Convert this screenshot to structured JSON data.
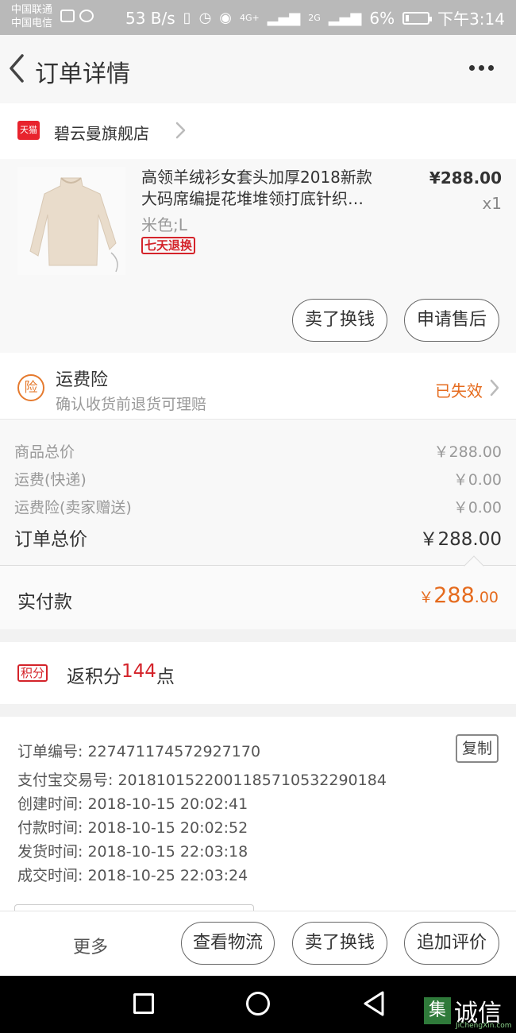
{
  "status_bar": {
    "carrier1": "中国联通",
    "carrier2": "中国电信",
    "speed": "53 B/s",
    "net4g": "4G+",
    "net2g": "2G",
    "battery": "6%",
    "time": "下午3:14"
  },
  "header": {
    "title": "订单详情"
  },
  "shop": {
    "badge": "天猫",
    "name": "碧云曼旗舰店"
  },
  "product": {
    "title_line1": "高领羊绒衫女套头加厚2018新款",
    "title_line2": "大码席编提花堆堆领打底针织…",
    "sku": "米色;L",
    "price": "¥288.00",
    "qty": "x1",
    "return_badge": "七天退换",
    "btn_sell": "卖了换钱",
    "btn_after_sale": "申请售后"
  },
  "insurance": {
    "icon_label": "险",
    "title": "运费险",
    "subtitle": "确认收货前退货可理赔",
    "status": "已失效"
  },
  "totals": {
    "goods_label": "商品总价",
    "goods_value": "￥288.00",
    "shipping_label": "运费(快递)",
    "shipping_value": "￥0.00",
    "insurance_label": "运费险(卖家赠送)",
    "insurance_value": "￥0.00",
    "order_total_label": "订单总价",
    "order_total_value": "￥288.00"
  },
  "paid": {
    "label": "实付款",
    "currency": "￥",
    "integer": "288",
    "decimal": ".00"
  },
  "points": {
    "badge": "积分",
    "prefix": "返积分",
    "number": "144",
    "suffix": "点"
  },
  "order_info": {
    "order_no": "订单编号: 227471174572927170",
    "alipay_no": "支付宝交易号: 2018101522001185710532290184",
    "created": "创建时间: 2018-10-15 20:02:41",
    "paid_time": "付款时间: 2018-10-15 20:02:52",
    "shipped": "发货时间: 2018-10-15 22:03:18",
    "completed": "成交时间: 2018-10-25 22:03:24",
    "copy_label": "复制"
  },
  "bottom_bar": {
    "more": "更多",
    "logistics": "查看物流",
    "sell": "卖了换钱",
    "review": "追加评价"
  },
  "watermark": {
    "icon": "集",
    "text": "诚信",
    "sub": "JiChengXin.com"
  }
}
